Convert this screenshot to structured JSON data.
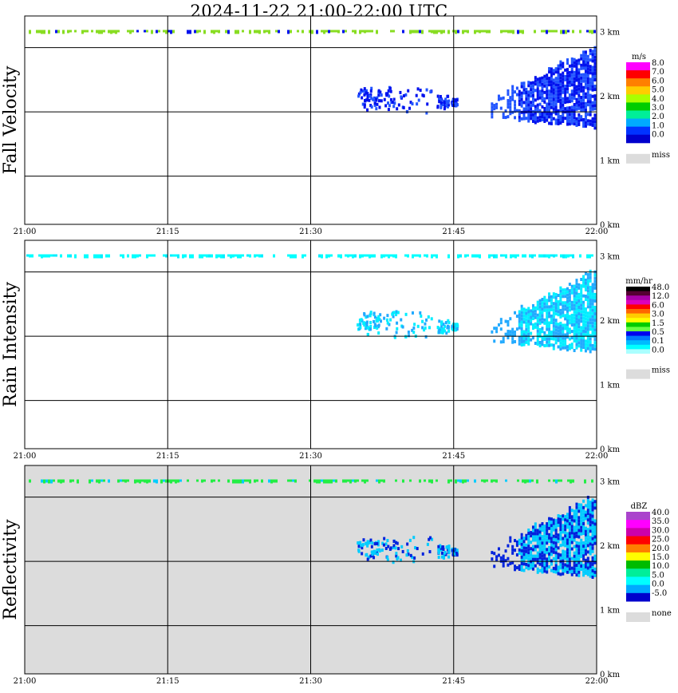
{
  "title": "2024-11-22   21:00-22:00 UTC",
  "chart_data": [
    {
      "type": "heatmap",
      "title": "Fall Velocity",
      "x_ticks": [
        "21:00",
        "21:15",
        "21:30",
        "21:45",
        "22:00"
      ],
      "y_ticks": [
        "0 km",
        "1 km",
        "2 km",
        "3 km"
      ],
      "ylim": [
        0,
        3.2
      ],
      "background": "#ffffff",
      "legend": {
        "unit": "m/s",
        "labels": [
          "8.0",
          "7.0",
          "6.0",
          "5.0",
          "4.0",
          "3.0",
          "2.0",
          "1.0",
          "0.0"
        ],
        "colors": [
          "#ff00ff",
          "#ff0000",
          "#ff7f00",
          "#ffcc00",
          "#aaff00",
          "#00cc00",
          "#00ee99",
          "#00aaff",
          "#0033ff",
          "#0000cc"
        ],
        "miss_label": "miss",
        "miss_color": "#dcdcdc"
      },
      "echo_colors": {
        "core": "#0011ee",
        "edge": "#2255ff",
        "rim": "#88dd22"
      }
    },
    {
      "type": "heatmap",
      "title": "Rain Intensity",
      "x_ticks": [
        "21:00",
        "21:15",
        "21:30",
        "21:45",
        "22:00"
      ],
      "y_ticks": [
        "0 km",
        "1 km",
        "2 km",
        "3 km"
      ],
      "ylim": [
        0,
        3.2
      ],
      "background": "#ffffff",
      "legend": {
        "unit": "mm/hr",
        "labels": [
          "48.0",
          "12.0",
          "6.0",
          "3.0",
          "1.5",
          "0.5",
          "0.1",
          "0.0"
        ],
        "colors": [
          "#000000",
          "#550033",
          "#aa00aa",
          "#dd00bb",
          "#ff0000",
          "#ff6600",
          "#ffcc00",
          "#ffff00",
          "#00cc00",
          "#66ff44",
          "#0000ee",
          "#0077ff",
          "#00bbff",
          "#00ffff",
          "#aaffff",
          "#ffffff"
        ],
        "miss_label": "miss",
        "miss_color": "#dcdcdc"
      },
      "echo_colors": {
        "core": "#00eeff",
        "edge": "#22aaff",
        "rim": "#00ffff"
      }
    },
    {
      "type": "heatmap",
      "title": "Reflectivity",
      "x_ticks": [
        "21:00",
        "21:15",
        "21:30",
        "21:45",
        "22:00"
      ],
      "y_ticks": [
        "0 km",
        "1 km",
        "2 km",
        "3 km"
      ],
      "ylim": [
        0,
        3.2
      ],
      "background": "#dcdcdc",
      "legend": {
        "unit": "dBZ",
        "labels": [
          "40.0",
          "35.0",
          "30.0",
          "25.0",
          "20.0",
          "15.0",
          "10.0",
          "5.0",
          "0.0",
          "-5.0"
        ],
        "colors": [
          "#aa44cc",
          "#ff00ff",
          "#cc00aa",
          "#ff0000",
          "#ff7f00",
          "#ffff00",
          "#00bb00",
          "#00ee99",
          "#00ffff",
          "#00aaff",
          "#0000cc"
        ],
        "miss_label": "none",
        "miss_color": "#dcdcdc"
      },
      "echo_colors": {
        "core": "#00ccff",
        "edge": "#0022dd",
        "rim": "#22ee44"
      }
    }
  ]
}
